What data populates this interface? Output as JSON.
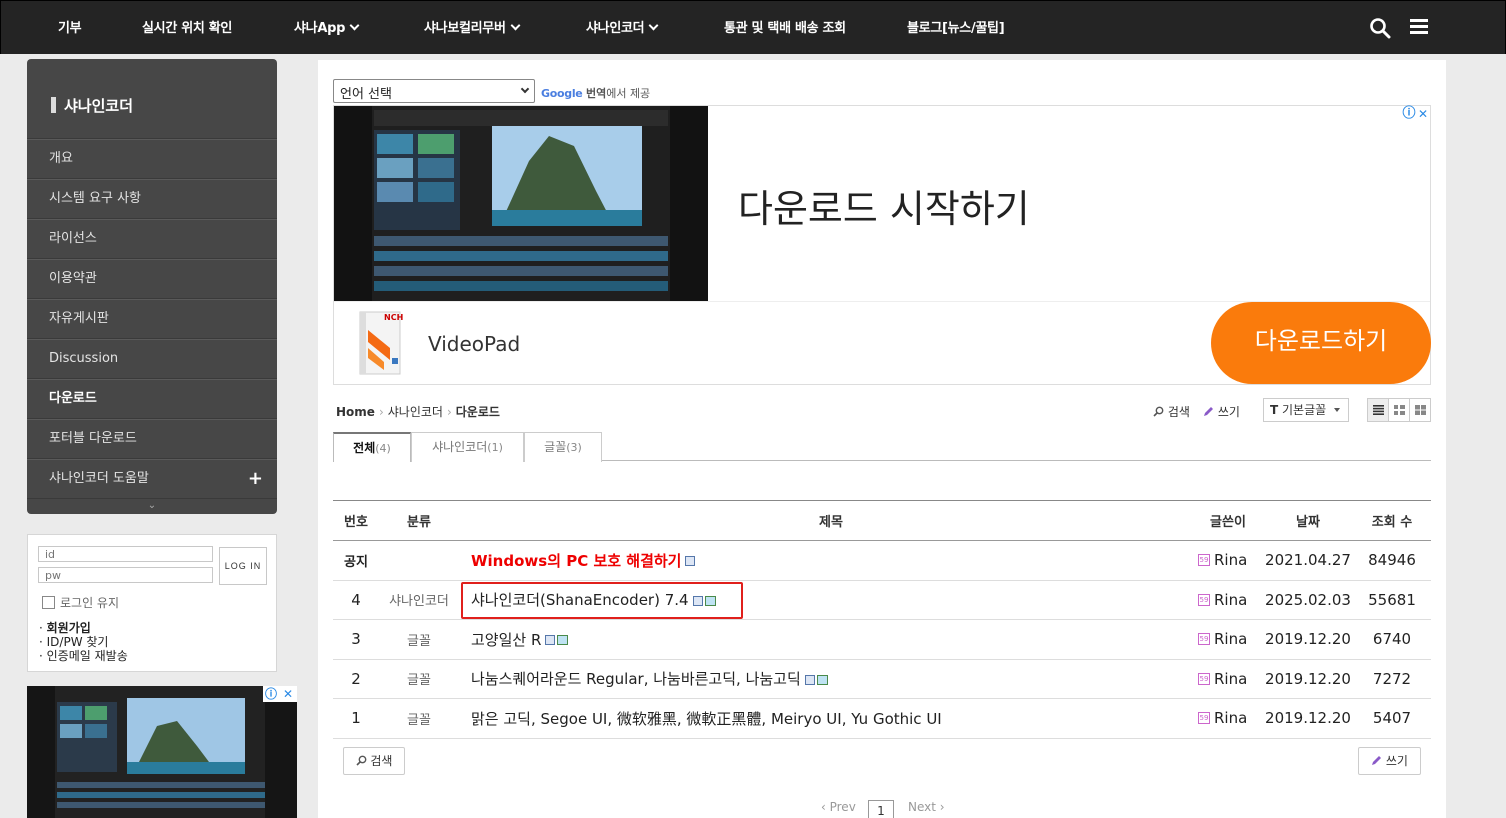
{
  "nav": {
    "items": [
      {
        "label": "기부",
        "dropdown": false
      },
      {
        "label": "실시간 위치 확인",
        "dropdown": false
      },
      {
        "label": "샤나App",
        "dropdown": true
      },
      {
        "label": "샤나보컬리무버",
        "dropdown": true
      },
      {
        "label": "샤나인코더",
        "dropdown": true
      },
      {
        "label": "통관 및 택배 배송 조회",
        "dropdown": false
      },
      {
        "label": "블로그[뉴스/꿀팁]",
        "dropdown": false
      }
    ]
  },
  "sidebar": {
    "title": "샤나인코더",
    "items": [
      {
        "label": "개요"
      },
      {
        "label": "시스템 요구 사항"
      },
      {
        "label": "라이선스"
      },
      {
        "label": "이용약관"
      },
      {
        "label": "자유게시판"
      },
      {
        "label": "Discussion"
      },
      {
        "label": "다운로드",
        "active": true
      },
      {
        "label": "포터블 다운로드"
      },
      {
        "label": "샤나인코더 도움말",
        "expand": "+"
      }
    ]
  },
  "login": {
    "id_placeholder": "id",
    "pw_placeholder": "pw",
    "login_label": "LOG IN",
    "keep_label": "로그인 유지",
    "signup": "회원가입",
    "find": "ID/PW 찾기",
    "resend": "인증메일 재발송"
  },
  "translate": {
    "select_label": "언어 선택",
    "google": "Google",
    "translate_word": "번역",
    "suffix": "에서 제공"
  },
  "ad": {
    "headline": "다운로드 시작하기",
    "app_name": "VideoPad",
    "cta": "다운로드하기",
    "logo_text": "NCH",
    "info_icon": "ⓘ",
    "close_icon": "✕"
  },
  "breadcrumb": {
    "home": "Home",
    "level1": "샤나인코더",
    "level2": "다운로드"
  },
  "toolbar": {
    "search": "검색",
    "write": "쓰기",
    "font": "기본글꼴",
    "font_prefix": "T"
  },
  "tabs": [
    {
      "label": "전체",
      "count": "(4)",
      "active": true
    },
    {
      "label": "샤나인코더",
      "count": "(1)",
      "active": false
    },
    {
      "label": "글꼴",
      "count": "(3)",
      "active": false
    }
  ],
  "table": {
    "headers": {
      "no": "번호",
      "category": "분류",
      "title": "제목",
      "author": "글쓴이",
      "date": "날짜",
      "views": "조회 수"
    },
    "rows": [
      {
        "no": "공지",
        "category": "",
        "title": "Windows의 PC 보호 해결하기",
        "author": "Rina",
        "date": "2021.04.27",
        "views": "84946",
        "notice": true,
        "file": true,
        "image": false
      },
      {
        "no": "4",
        "category": "샤나인코더",
        "title": "샤나인코더(ShanaEncoder) 7.4",
        "author": "Rina",
        "date": "2025.02.03",
        "views": "55681",
        "notice": false,
        "file": true,
        "image": true
      },
      {
        "no": "3",
        "category": "글꼴",
        "title": "고양일산 R",
        "author": "Rina",
        "date": "2019.12.20",
        "views": "6740",
        "notice": false,
        "file": true,
        "image": true
      },
      {
        "no": "2",
        "category": "글꼴",
        "title": "나눔스퀘어라운드 Regular, 나눔바른고딕, 나눔고딕",
        "author": "Rina",
        "date": "2019.12.20",
        "views": "7272",
        "notice": false,
        "file": true,
        "image": true
      },
      {
        "no": "1",
        "category": "글꼴",
        "title": "맑은 고딕, Segoe UI, 微软雅黑, 微軟正黑體, Meiryo UI, Yu Gothic UI",
        "author": "Rina",
        "date": "2019.12.20",
        "views": "5407",
        "notice": false,
        "file": false,
        "image": false
      }
    ]
  },
  "bottom": {
    "search": "검색",
    "write": "쓰기"
  },
  "pagination": {
    "prev": "‹ Prev",
    "current": "1",
    "next": "Next ›"
  },
  "colors": {
    "nav_bg": "#242424",
    "sidebar_bg": "#474747",
    "cta_orange": "#fa7b0c",
    "notice_red": "#e00000",
    "highlight_red": "#e0201c"
  }
}
